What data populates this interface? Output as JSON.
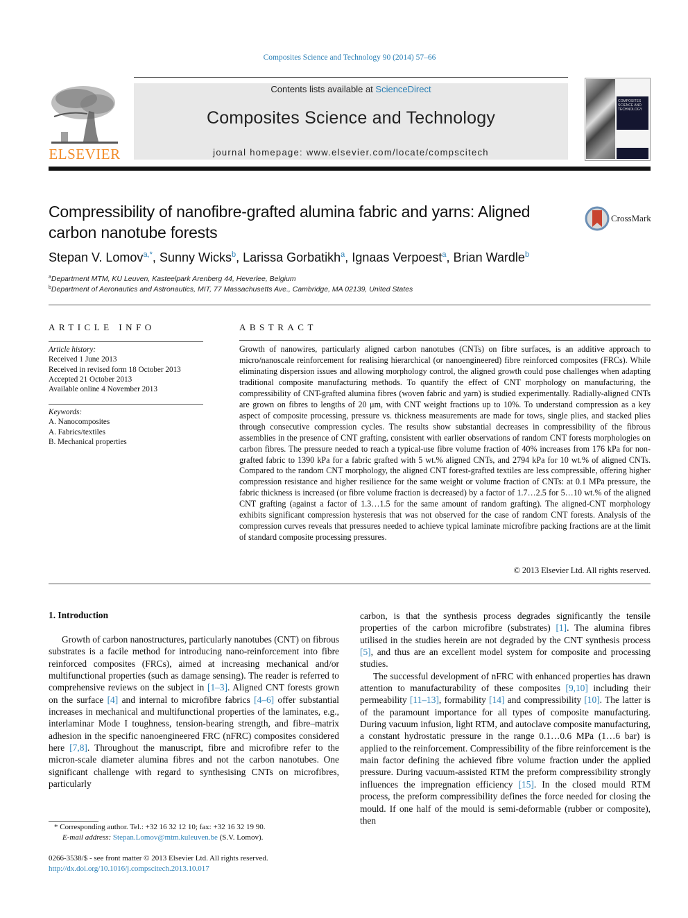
{
  "header": {
    "citation": "Composites Science and Technology 90 (2014) 57–66",
    "contents_prefix": "Contents lists available at ",
    "contents_link": "ScienceDirect",
    "journal_title": "Composites Science and Technology",
    "homepage": "journal homepage: www.elsevier.com/locate/compscitech",
    "publisher_logo": "ELSEVIER",
    "cover_text": "COMPOSITES SCIENCE AND TECHNOLOGY",
    "colors": {
      "link": "#2a7fb5",
      "elsevier_orange": "#f28c28"
    }
  },
  "article": {
    "title": "Compressibility of nanofibre-grafted alumina fabric and yarns: Aligned carbon nanotube forests",
    "crossmark_label": "CrossMark",
    "authors": [
      {
        "name": "Stepan V. Lomov",
        "sup": "a,*"
      },
      {
        "name": "Sunny Wicks",
        "sup": "b"
      },
      {
        "name": "Larissa Gorbatikh",
        "sup": "a"
      },
      {
        "name": "Ignaas Verpoest",
        "sup": "a"
      },
      {
        "name": "Brian Wardle",
        "sup": "b"
      }
    ],
    "affiliations": [
      {
        "key": "a",
        "text": "Department MTM, KU Leuven, Kasteelpark Arenberg 44, Heverlee, Belgium"
      },
      {
        "key": "b",
        "text": "Department of Aeronautics and Astronautics, MIT, 77 Massachusetts Ave., Cambridge, MA 02139, United States"
      }
    ]
  },
  "article_info": {
    "heading": "ARTICLE INFO",
    "history_label": "Article history:",
    "history": [
      "Received 1 June 2013",
      "Received in revised form 18 October 2013",
      "Accepted 21 October 2013",
      "Available online 4 November 2013"
    ],
    "keywords_label": "Keywords:",
    "keywords": [
      "A. Nanocomposites",
      "A. Fabrics/textiles",
      "B. Mechanical properties"
    ]
  },
  "abstract": {
    "heading": "ABSTRACT",
    "text": "Growth of nanowires, particularly aligned carbon nanotubes (CNTs) on fibre surfaces, is an additive approach to micro/nanoscale reinforcement for realising hierarchical (or nanoengineered) fibre reinforced composites (FRCs). While eliminating dispersion issues and allowing morphology control, the aligned growth could pose challenges when adapting traditional composite manufacturing methods. To quantify the effect of CNT morphology on manufacturing, the compressibility of CNT-grafted alumina fibres (woven fabric and yarn) is studied experimentally. Radially-aligned CNTs are grown on fibres to lengths of 20 μm, with CNT weight fractions up to 10%. To understand compression as a key aspect of composite processing, pressure vs. thickness measurements are made for tows, single plies, and stacked plies through consecutive compression cycles. The results show substantial decreases in compressibility of the fibrous assemblies in the presence of CNT grafting, consistent with earlier observations of random CNT forests morphologies on carbon fibres. The pressure needed to reach a typical-use fibre volume fraction of 40% increases from 176 kPa for non-grafted fabric to 1390 kPa for a fabric grafted with 5 wt.% aligned CNTs, and 2794 kPa for 10 wt.% of aligned CNTs. Compared to the random CNT morphology, the aligned CNT forest-grafted textiles are less compressible, offering higher compression resistance and higher resilience for the same weight or volume fraction of CNTs: at 0.1 MPa pressure, the fabric thickness is increased (or fibre volume fraction is decreased) by a factor of 1.7…2.5 for 5…10 wt.% of the aligned CNT grafting (against a factor of 1.3…1.5 for the same amount of random grafting). The aligned-CNT morphology exhibits significant compression hysteresis that was not observed for the case of random CNT forests. Analysis of the compression curves reveals that pressures needed to achieve typical laminate microfibre packing fractions are at the limit of standard composite processing pressures.",
    "copyright": "© 2013 Elsevier Ltd. All rights reserved."
  },
  "body": {
    "section_heading": "1. Introduction",
    "left_paragraph": [
      {
        "t": "Growth of carbon nanostructures, particularly nanotubes (CNT) on fibrous substrates is a facile method for introducing nano-reinforcement into fibre reinforced composites (FRCs), aimed at increasing mechanical and/or multifunctional properties (such as damage sensing). The reader is referred to comprehensive reviews on the subject in "
      },
      {
        "ref": "[1–3]"
      },
      {
        "t": ". Aligned CNT forests grown on the surface "
      },
      {
        "ref": "[4]"
      },
      {
        "t": " and internal to microfibre fabrics "
      },
      {
        "ref": "[4–6]"
      },
      {
        "t": " offer substantial increases in mechanical and multifunctional properties of the laminates, e.g., interlaminar Mode I toughness, tension-bearing strength, and fibre–matrix adhesion in the specific nanoengineered FRC (nFRC) composites considered here "
      },
      {
        "ref": "[7,8]"
      },
      {
        "t": ". Throughout the manuscript, fibre and microfibre refer to the micron-scale diameter alumina fibres and not the carbon nanotubes. One significant challenge with regard to synthesising CNTs on microfibres, particularly"
      }
    ],
    "right_paragraph_1": [
      {
        "t": "carbon, is that the synthesis process degrades significantly the tensile properties of the carbon microfibre (substrates) "
      },
      {
        "ref": "[1]"
      },
      {
        "t": ". The alumina fibres utilised in the studies herein are not degraded by the CNT synthesis process "
      },
      {
        "ref": "[5]"
      },
      {
        "t": ", and thus are an excellent model system for composite and processing studies."
      }
    ],
    "right_paragraph_2": [
      {
        "t": "The successful development of nFRC with enhanced properties has drawn attention to manufacturability of these composites "
      },
      {
        "ref": "[9,10]"
      },
      {
        "t": " including their permeability "
      },
      {
        "ref": "[11–13]"
      },
      {
        "t": ", formability "
      },
      {
        "ref": "[14]"
      },
      {
        "t": " and compressibility "
      },
      {
        "ref": "[10]"
      },
      {
        "t": ". The latter is of the paramount importance for all types of composite manufacturing. During vacuum infusion, light RTM, and autoclave composite manufacturing, a constant hydrostatic pressure in the range 0.1…0.6 MPa (1…6 bar) is applied to the reinforcement. Compressibility of the fibre reinforcement is the main factor defining the achieved fibre volume fraction under the applied pressure. During vacuum-assisted RTM the preform compressibility strongly influences the impregnation efficiency "
      },
      {
        "ref": "[15]"
      },
      {
        "t": ". In the closed mould RTM process, the preform compressibility defines the force needed for closing the mould. If one half of the mould is semi-deformable (rubber or composite), then"
      }
    ]
  },
  "footnotes": {
    "corresponding": "* Corresponding author. Tel.: +32 16 32 12 10; fax: +32 16 32 19 90.",
    "email_label": "E-mail address: ",
    "email": "Stepan.Lomov@mtm.kuleuven.be",
    "email_suffix": " (S.V. Lomov).",
    "issn": "0266-3538/$ - see front matter © 2013 Elsevier Ltd. All rights reserved.",
    "doi": "http://dx.doi.org/10.1016/j.compscitech.2013.10.017"
  }
}
